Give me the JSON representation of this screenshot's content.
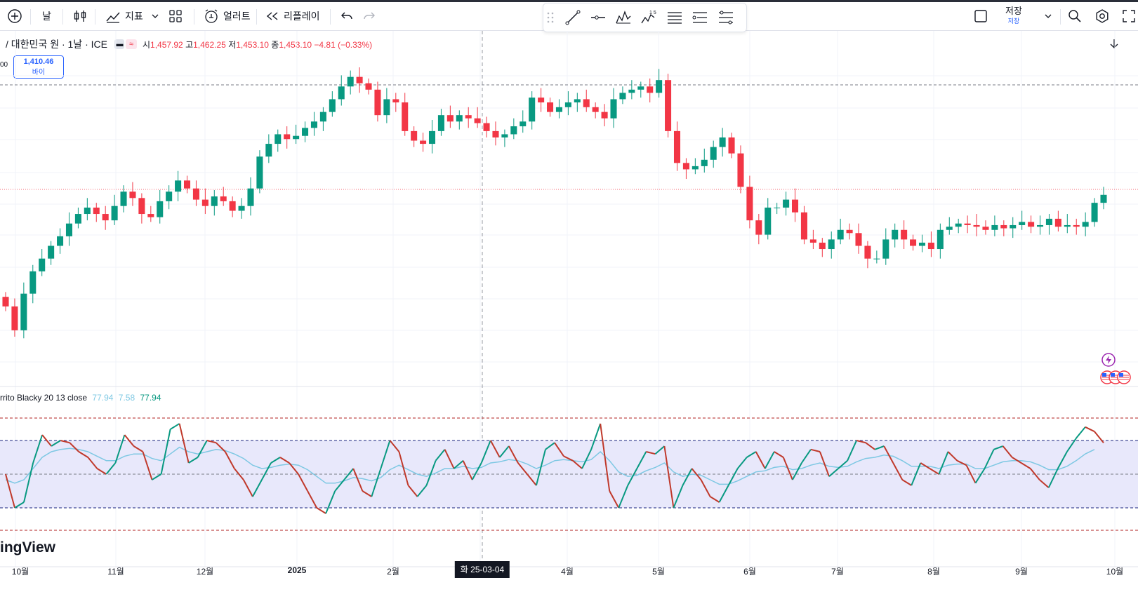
{
  "toolbar": {
    "interval": "날",
    "indicators": "지표",
    "alert": "얼러트",
    "replay": "리플레이",
    "save_label": "저장",
    "save_sub": "저장"
  },
  "legend": {
    "title": "/ 대한민국 원 · 1날 · ICE",
    "open_label": "시",
    "open": "1,457.92",
    "high_label": "고",
    "high": "1,462.25",
    "low_label": "저",
    "low": "1,453.10",
    "close_label": "종",
    "close": "1,453.10",
    "change": "−4.81 (−0.33%)"
  },
  "buy_box": {
    "price": "1,410.46",
    "label": "바이"
  },
  "y_cut_label": "00",
  "indicator_legend": {
    "name": "rrito Blacky 20 13 close",
    "v1": "77.94",
    "v2": "7.58",
    "v3": "77.94"
  },
  "watermark": "ingView",
  "x_axis": {
    "labels": [
      "10월",
      "11월",
      "12월",
      "2025",
      "2월",
      "4월",
      "5월",
      "6월",
      "7월",
      "8월",
      "9월",
      "10월"
    ],
    "crosshair": "화 25-03-04"
  },
  "colors": {
    "up": "#089981",
    "down": "#f23645",
    "osc_signal": "#7ec8e3",
    "band": "#e8e8fb"
  },
  "chart_data": [
    {
      "type": "candlestick",
      "title": "",
      "series": [
        {
          "name": "close",
          "values": [
            1330,
            1315,
            1338,
            1352,
            1360,
            1368,
            1374,
            1382,
            1388,
            1392,
            1388,
            1384,
            1393,
            1402,
            1398,
            1388,
            1386,
            1396,
            1402,
            1409,
            1404,
            1397,
            1393,
            1399,
            1396,
            1390,
            1393,
            1404,
            1424,
            1432,
            1438,
            1435,
            1437,
            1442,
            1446,
            1452,
            1460,
            1468,
            1474,
            1470,
            1466,
            1450,
            1460,
            1458,
            1440,
            1434,
            1432,
            1440,
            1450,
            1446,
            1450,
            1448,
            1445,
            1440,
            1436,
            1438,
            1443,
            1446,
            1461,
            1458,
            1452,
            1455,
            1458,
            1460,
            1455,
            1452,
            1448,
            1460,
            1464,
            1466,
            1468,
            1464,
            1472,
            1440,
            1420,
            1416,
            1418,
            1422,
            1430,
            1436,
            1426,
            1405,
            1384,
            1375,
            1392,
            1392,
            1397,
            1389,
            1372,
            1370,
            1366,
            1372,
            1378,
            1376,
            1368,
            1360,
            1360,
            1372,
            1378,
            1372,
            1368,
            1370,
            1366,
            1378,
            1380,
            1382,
            1381,
            1380,
            1378,
            1381,
            1379,
            1381,
            1383,
            1380,
            1381,
            1385,
            1380,
            1381,
            1380,
            1383,
            1395,
            1400
          ]
        }
      ]
    },
    {
      "type": "line",
      "title": "",
      "ylim": [
        0,
        100
      ],
      "series": [
        {
          "name": "",
          "values": [
            50,
            20,
            25,
            60,
            85,
            75,
            80,
            78,
            70,
            65,
            55,
            50,
            60,
            85,
            75,
            70,
            45,
            50,
            90,
            95,
            60,
            65,
            80,
            78,
            70,
            55,
            45,
            30,
            45,
            60,
            65,
            60,
            50,
            35,
            20,
            15,
            35,
            45,
            55,
            35,
            30,
            55,
            80,
            70,
            40,
            30,
            40,
            62,
            72,
            55,
            62,
            45,
            60,
            80,
            65,
            75,
            60,
            50,
            40,
            72,
            78,
            66,
            62,
            55,
            72,
            95,
            35,
            20,
            40,
            55,
            70,
            68,
            75,
            20,
            40,
            55,
            45,
            30,
            25,
            40,
            55,
            65,
            70,
            55,
            70,
            65,
            45,
            60,
            72,
            70,
            48,
            55,
            62,
            80,
            78,
            72,
            75,
            60,
            45,
            40,
            60,
            55,
            50,
            70,
            62,
            58,
            42,
            55,
            72,
            75,
            65,
            60,
            55,
            45,
            38,
            55,
            70,
            82,
            92,
            88,
            77.94
          ]
        },
        {
          "name": "",
          "values": [
            45,
            42,
            45,
            55,
            65,
            70,
            72,
            73,
            72,
            70,
            66,
            62,
            62,
            66,
            68,
            68,
            64,
            62,
            68,
            74,
            70,
            68,
            70,
            72,
            71,
            68,
            64,
            58,
            55,
            56,
            58,
            59,
            58,
            54,
            48,
            42,
            42,
            44,
            47,
            46,
            44,
            47,
            54,
            58,
            54,
            50,
            48,
            51,
            55,
            55,
            57,
            55,
            56,
            60,
            61,
            63,
            62,
            59,
            55,
            58,
            62,
            63,
            62,
            61,
            63,
            70,
            62,
            52,
            48,
            49,
            53,
            56,
            60,
            52,
            48,
            50,
            49,
            45,
            41,
            41,
            44,
            48,
            52,
            53,
            56,
            57,
            54,
            55,
            58,
            60,
            57,
            56,
            57,
            61,
            64,
            65,
            67,
            66,
            62,
            57,
            57,
            57,
            55,
            58,
            59,
            59,
            55,
            55,
            58,
            61,
            62,
            62,
            61,
            58,
            54,
            54,
            57,
            62,
            68,
            72,
            7.58
          ]
        }
      ]
    }
  ]
}
